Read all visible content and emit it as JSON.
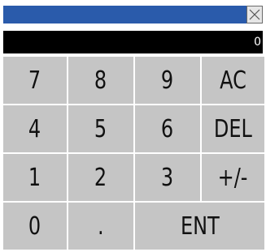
{
  "titlebar": {
    "close_icon": "close-x-icon"
  },
  "display": {
    "value": "0"
  },
  "keys": {
    "k7": "7",
    "k8": "8",
    "k9": "9",
    "ac": "AC",
    "k4": "4",
    "k5": "5",
    "k6": "6",
    "del": "DEL",
    "k1": "1",
    "k2": "2",
    "k3": "3",
    "plusminus": "+/-",
    "k0": "0",
    "dot": ".",
    "ent": "ENT"
  },
  "colors": {
    "titlebar": "#2a5bab",
    "display_bg": "#000000",
    "display_text": "#ffffff",
    "key_bg": "#c5c5c5"
  }
}
